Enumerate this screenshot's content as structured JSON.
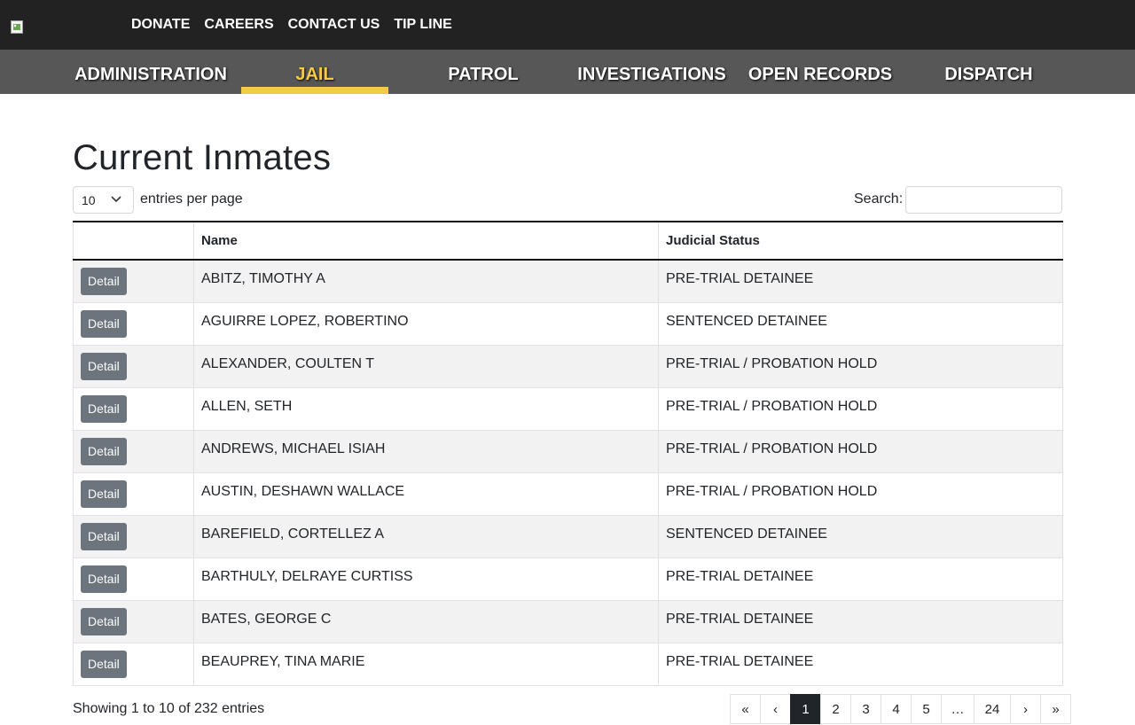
{
  "header": {
    "top_links": [
      "DONATE",
      "CAREERS",
      "CONTACT US",
      "TIP LINE"
    ]
  },
  "nav": {
    "items": [
      "ADMINISTRATION",
      "JAIL",
      "PATROL",
      "INVESTIGATIONS",
      "OPEN RECORDS",
      "DISPATCH"
    ],
    "active": "JAIL"
  },
  "page_title": "Current Inmates",
  "controls": {
    "entries_value": "10",
    "entries_label": "entries per page",
    "search_label": "Search:",
    "search_value": ""
  },
  "table": {
    "columns": [
      "",
      "Name",
      "Judicial Status"
    ],
    "detail_label": "Detail",
    "rows": [
      {
        "name": "ABITZ, TIMOTHY A",
        "status": "PRE-TRIAL DETAINEE"
      },
      {
        "name": "AGUIRRE LOPEZ, ROBERTINO",
        "status": "SENTENCED DETAINEE"
      },
      {
        "name": "ALEXANDER, COULTEN T",
        "status": "PRE-TRIAL / PROBATION HOLD"
      },
      {
        "name": "ALLEN, SETH",
        "status": "PRE-TRIAL / PROBATION HOLD"
      },
      {
        "name": "ANDREWS, MICHAEL ISIAH",
        "status": "PRE-TRIAL / PROBATION HOLD"
      },
      {
        "name": "AUSTIN, DESHAWN WALLACE",
        "status": "PRE-TRIAL / PROBATION HOLD"
      },
      {
        "name": "BAREFIELD, CORTELLEZ A",
        "status": "SENTENCED DETAINEE"
      },
      {
        "name": "BARTHULY, DELRAYE CURTISS",
        "status": "PRE-TRIAL DETAINEE"
      },
      {
        "name": "BATES, GEORGE C",
        "status": "PRE-TRIAL DETAINEE"
      },
      {
        "name": "BEAUPREY, TINA MARIE",
        "status": "PRE-TRIAL DETAINEE"
      }
    ]
  },
  "footer": {
    "showing_text": "Showing 1 to 10 of 232 entries",
    "pages": [
      "«",
      "‹",
      "1",
      "2",
      "3",
      "4",
      "5",
      "…",
      "24",
      "›",
      "»"
    ],
    "active_page": "1"
  },
  "colors": {
    "topbar": "#222222",
    "navbar": "#575757",
    "accent": "#f7c948",
    "button": "#6c757d"
  }
}
